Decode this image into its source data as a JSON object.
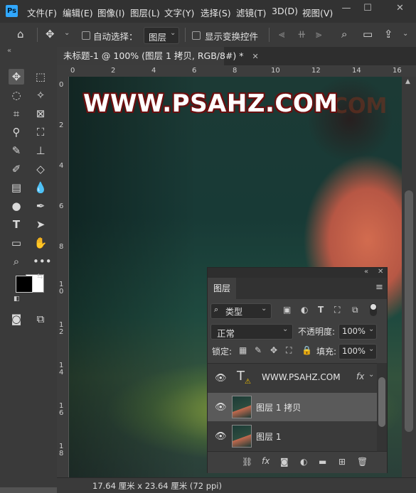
{
  "app": {
    "logo": "Ps"
  },
  "menu": [
    "文件(F)",
    "编辑(E)",
    "图像(I)",
    "图层(L)",
    "文字(Y)",
    "选择(S)",
    "滤镜(T)",
    "3D(D)",
    "视图(V)"
  ],
  "options": {
    "auto_select_label": "自动选择：",
    "auto_select_value": "图层",
    "show_transform_label": "显示变换控件"
  },
  "document": {
    "tab_title": "未标题-1 @ 100% (图层 1 拷贝, RGB/8#) *",
    "watermark": "WWW.PSAHZ.COM",
    "watermark_echo": "COM"
  },
  "ruler": {
    "h": [
      "0",
      "2",
      "4",
      "6",
      "8",
      "10",
      "12",
      "14",
      "16"
    ],
    "v": [
      "0",
      "2",
      "4",
      "6",
      "8",
      "1\n0",
      "1\n2",
      "1\n4",
      "1\n6",
      "1\n8"
    ]
  },
  "status": {
    "doc_size": "17.64 厘米 x 23.64 厘米 (72 ppi)"
  },
  "layers_panel": {
    "tab": "图层",
    "filter_kind": "类型",
    "blend_mode": "正常",
    "opacity_label": "不透明度:",
    "opacity_value": "100%",
    "lock_label": "锁定:",
    "fill_label": "填充:",
    "fill_value": "100%",
    "layers": [
      {
        "name": "WWW.PSAHZ.COM",
        "type": "text",
        "fx": "fx",
        "selected": false
      },
      {
        "name": "图层 1 拷贝",
        "type": "pixel",
        "selected": true
      },
      {
        "name": "图层 1",
        "type": "pixel",
        "selected": false
      }
    ]
  },
  "colors": {
    "accent": "#31a8ff",
    "ui_dark": "#323232",
    "ui_panel": "#3a3a3a",
    "selected_row": "#5a5a5a"
  },
  "icons": [
    "home-icon",
    "move-icon",
    "search-icon",
    "workspace-icon",
    "share-icon",
    "eye-icon",
    "text-layer-icon",
    "warning-icon"
  ]
}
